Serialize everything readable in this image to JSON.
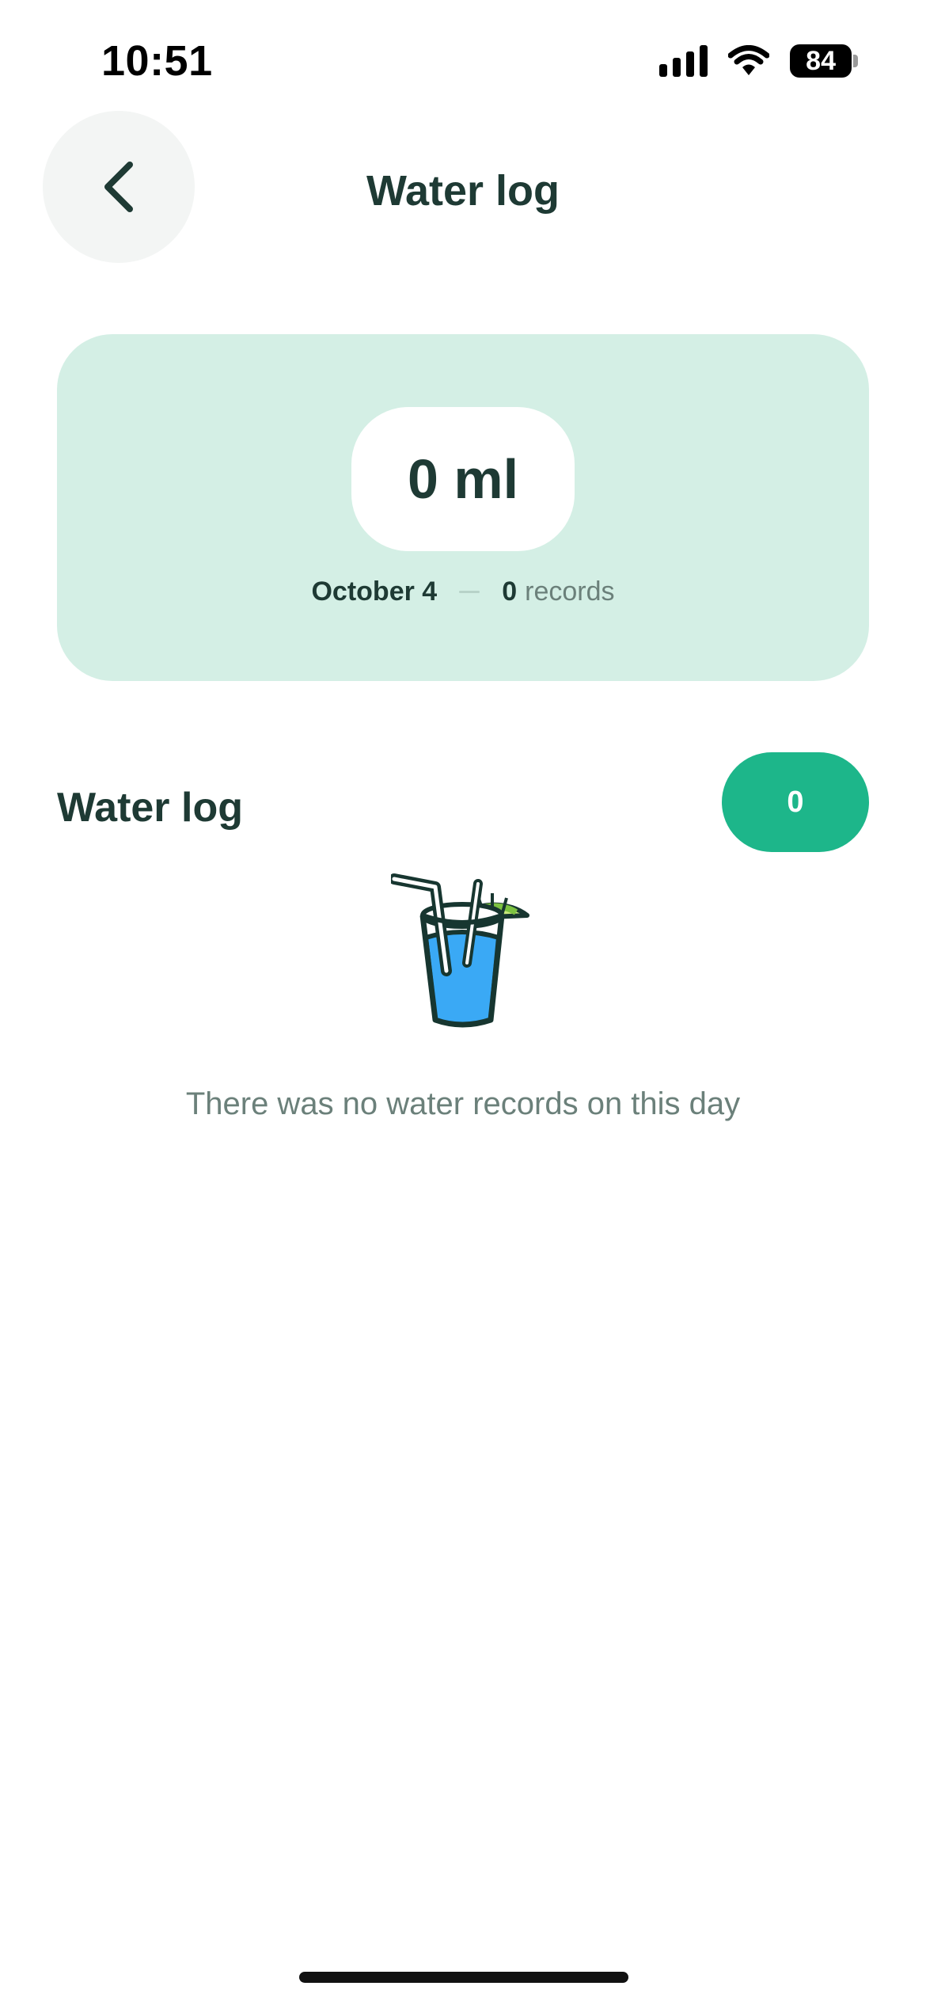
{
  "status_bar": {
    "time": "10:51",
    "battery_level": "84"
  },
  "header": {
    "title": "Water log",
    "back_icon": "chevron-left-icon"
  },
  "summary": {
    "amount": "0 ml",
    "date": "October 4",
    "record_count": "0",
    "records_label": "records"
  },
  "section": {
    "title": "Water log",
    "count": "0"
  },
  "empty_state": {
    "icon": "drink-glass-icon",
    "message": "There was no water records on this day"
  },
  "colors": {
    "accent": "#1db68a",
    "card_background": "#d4efe5",
    "text_primary": "#1e3a34",
    "text_secondary": "#6b807a",
    "water": "#3aa9f5"
  }
}
